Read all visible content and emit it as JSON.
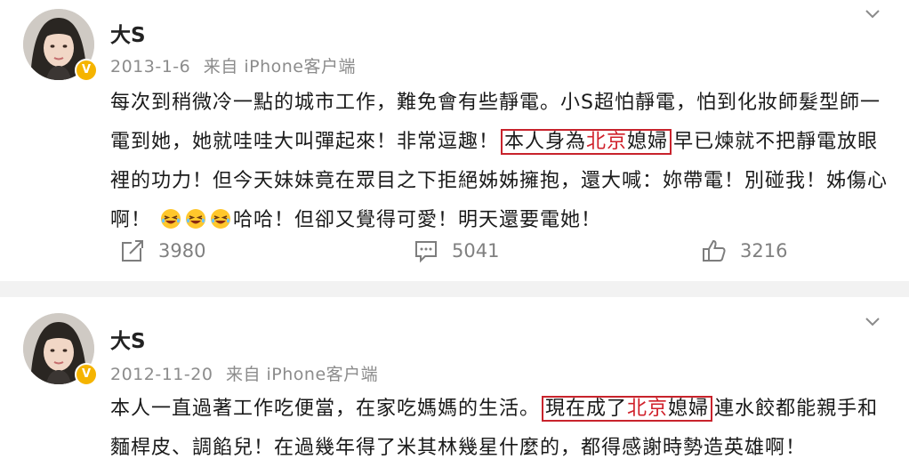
{
  "posts": [
    {
      "author": "大S",
      "date": "2013-1-6",
      "source": "来自 iPhone客户端",
      "text_1": "每次到稍微冷一點的城市工作，難免會有些靜電。小S超怕靜電，怕到化妝師髮型師一電到她，她就哇哇大叫彈起來！非常逗趣！",
      "highlight_pre": "本人身為",
      "highlight_red": "北京",
      "highlight_post": "媳婦",
      "text_2": "早已煉就不把靜電放眼裡的功力！但今天妹妹竟在眾目之下拒絕姊姊擁抱，還大喊：妳帶電！別碰我！姊傷心啊！",
      "emoji_icon": "laughing-tears-emoji",
      "text_3": "哈哈！但卻又覺得可愛！明天還要電她！",
      "repost_count": "3980",
      "comment_count": "5041",
      "like_count": "3216"
    },
    {
      "author": "大S",
      "date": "2012-11-20",
      "source": "来自 iPhone客户端",
      "text_1": "本人一直過著工作吃便當，在家吃媽媽的生活。",
      "highlight_pre": "現在成了",
      "highlight_red": "北京",
      "highlight_post": "媳婦",
      "text_2": "連水餃都能親手和麵桿皮、調餡兒！在過幾年得了米其林幾星什麼的，都得感謝時勢造英雄啊！"
    }
  ],
  "colors": {
    "highlight_border": "#c8232c",
    "highlight_text": "#d0202a",
    "verified_badge": "#f5b400",
    "muted_text": "#808080"
  },
  "icons": {
    "repost": "repost-icon",
    "comment": "comment-icon",
    "like": "thumbs-up-icon",
    "menu": "chevron-down-icon",
    "verified": "verified-v-badge"
  },
  "verified_label": "V"
}
